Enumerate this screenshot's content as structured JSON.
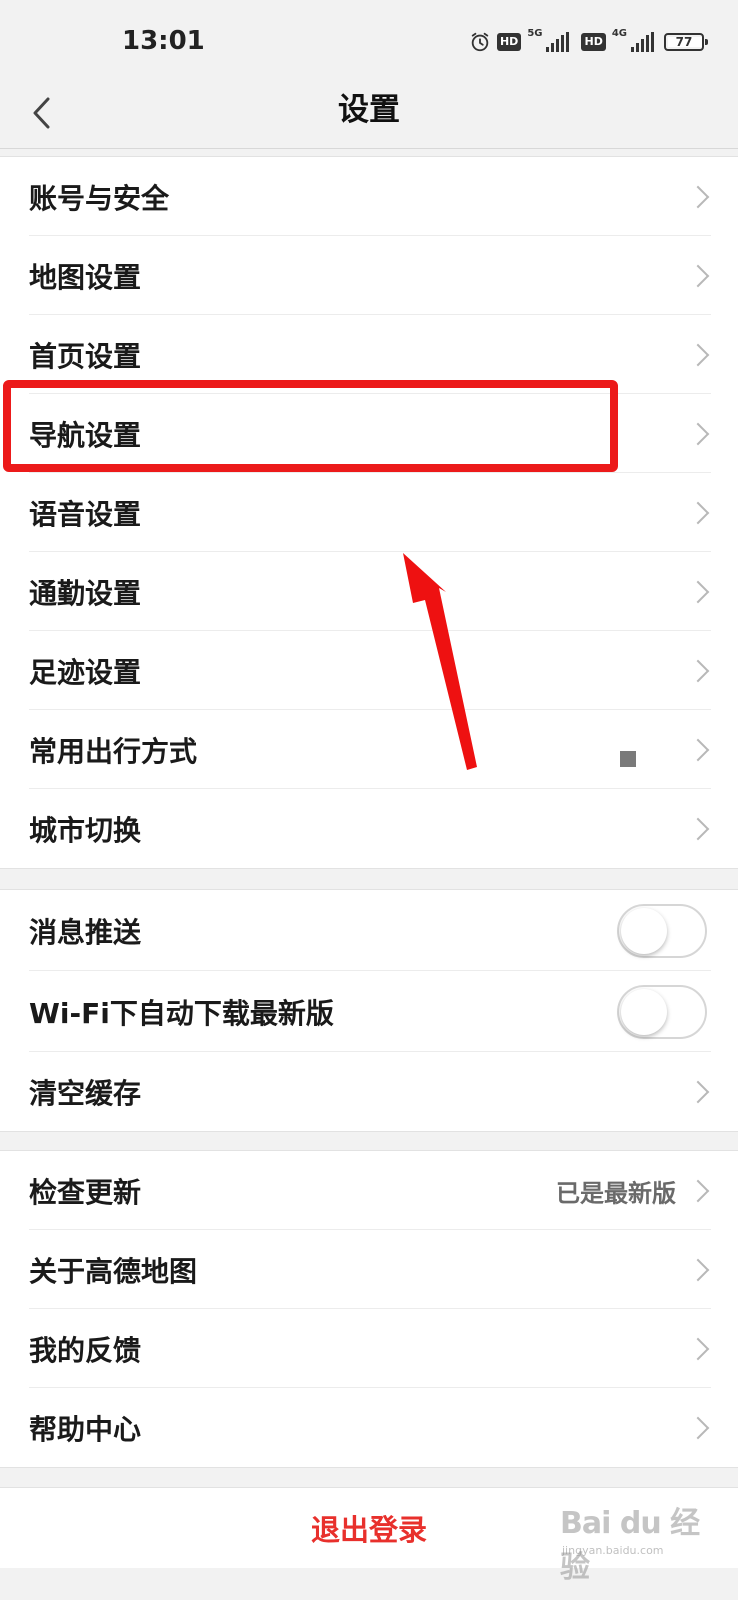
{
  "status_bar": {
    "time": "13:01",
    "alarm_icon": "alarm-clock-icon",
    "sim1": {
      "hd": "HD",
      "network": "5G"
    },
    "sim2": {
      "hd": "HD",
      "network": "4G"
    },
    "battery": "77"
  },
  "nav": {
    "title": "设置",
    "back_icon": "chevron-left-icon"
  },
  "groups": {
    "main": [
      {
        "label": "账号与安全"
      },
      {
        "label": "地图设置"
      },
      {
        "label": "首页设置"
      },
      {
        "label": "导航设置"
      },
      {
        "label": "语音设置"
      },
      {
        "label": "通勤设置"
      },
      {
        "label": "足迹设置"
      },
      {
        "label": "常用出行方式"
      },
      {
        "label": "城市切换"
      }
    ],
    "prefs": [
      {
        "label": "消息推送",
        "toggle": false
      },
      {
        "label": "Wi-Fi下自动下载最新版",
        "toggle": false
      },
      {
        "label": "清空缓存"
      }
    ],
    "about": [
      {
        "label": "检查更新",
        "value": "已是最新版"
      },
      {
        "label": "关于高德地图"
      },
      {
        "label": "我的反馈"
      },
      {
        "label": "帮助中心"
      }
    ]
  },
  "logout": {
    "label": "退出登录"
  },
  "annotation": {
    "highlight_color": "#ec1a1a",
    "arrow_color": "#ee1111"
  },
  "watermark": {
    "text": "Bai du 经验",
    "sub": "jingyan.baidu.com"
  }
}
